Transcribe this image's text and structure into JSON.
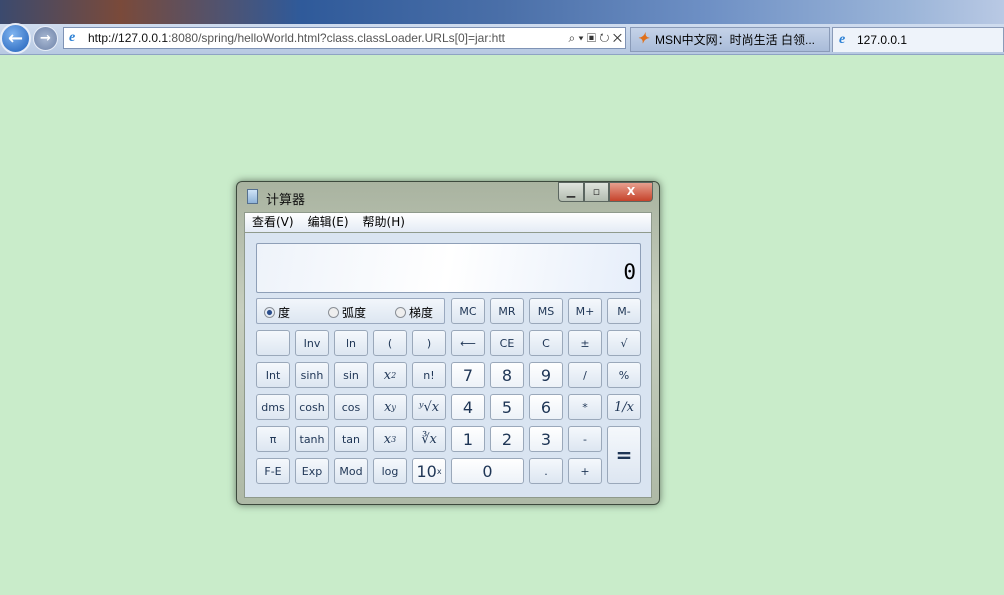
{
  "browser": {
    "address_host": "http://127.0.0.1",
    "address_rest": ":8080/spring/helloWorld.html?class.classLoader.URLs[0]=jar:htt",
    "address_icons": "⌕ ▾ ▣ ↻ ✕",
    "tabs": [
      {
        "label": "MSN中文网：时尚生活 白领..."
      },
      {
        "label": "127.0.0.1"
      }
    ]
  },
  "calculator": {
    "title": "计算器",
    "menu": [
      "查看(V)",
      "编辑(E)",
      "帮助(H)"
    ],
    "display": "0",
    "angle_modes": [
      {
        "label": "度",
        "selected": true
      },
      {
        "label": "弧度",
        "selected": false
      },
      {
        "label": "梯度",
        "selected": false
      }
    ],
    "memory_buttons": [
      "MC",
      "MR",
      "MS",
      "M+",
      "M-"
    ],
    "buttons": [
      [
        {
          "l": ""
        },
        {
          "l": "Inv"
        },
        {
          "l": "ln"
        },
        {
          "l": "("
        },
        {
          "l": ")"
        },
        {
          "l": "⟵"
        },
        {
          "l": "CE"
        },
        {
          "l": "C"
        },
        {
          "l": "±"
        },
        {
          "l": "√"
        }
      ],
      [
        {
          "l": "Int"
        },
        {
          "l": "sinh"
        },
        {
          "l": "sin"
        },
        {
          "l": "x",
          "s": "2",
          "m": 1
        },
        {
          "l": "n!"
        },
        {
          "l": "7",
          "n": 1
        },
        {
          "l": "8",
          "n": 1
        },
        {
          "l": "9",
          "n": 1
        },
        {
          "l": "/"
        },
        {
          "l": "%"
        }
      ],
      [
        {
          "l": "dms"
        },
        {
          "l": "cosh"
        },
        {
          "l": "cos"
        },
        {
          "l": "x",
          "s": "y",
          "m": 1
        },
        {
          "l": "ʸ√x",
          "m": 1
        },
        {
          "l": "4",
          "n": 1
        },
        {
          "l": "5",
          "n": 1
        },
        {
          "l": "6",
          "n": 1
        },
        {
          "l": "*"
        },
        {
          "l": "1/x",
          "m": 1
        }
      ],
      [
        {
          "l": "π"
        },
        {
          "l": "tanh"
        },
        {
          "l": "tan"
        },
        {
          "l": "x",
          "s": "3",
          "m": 1
        },
        {
          "l": "∛x",
          "m": 1
        },
        {
          "l": "1",
          "n": 1
        },
        {
          "l": "2",
          "n": 1
        },
        {
          "l": "3",
          "n": 1
        },
        {
          "l": "-"
        },
        {
          "l": "=",
          "eq": 1
        }
      ],
      [
        {
          "l": "F-E"
        },
        {
          "l": "Exp"
        },
        {
          "l": "Mod"
        },
        {
          "l": "log"
        },
        {
          "l": "10",
          "s": "x",
          "n": 1
        },
        {
          "l": "0",
          "n": 1,
          "w": 2
        },
        {
          "l": "."
        },
        {
          "l": "+"
        }
      ]
    ]
  }
}
